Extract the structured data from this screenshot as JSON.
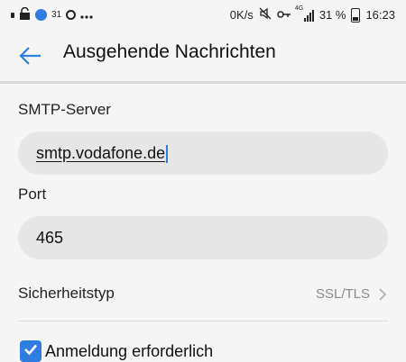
{
  "status_bar": {
    "small_battery_pct": "31",
    "net_speed": "0K/s",
    "network_type": "4G",
    "battery_pct": "31 %",
    "time": "16:23",
    "icons": [
      "notification-dot-icon",
      "lock-icon",
      "globe-icon",
      "loading-ring-icon",
      "more-icon",
      "mute-icon",
      "key-icon",
      "signal-icon",
      "battery-icon"
    ]
  },
  "header": {
    "title": "Ausgehende Nachrichten",
    "back_icon": "arrow-left-icon"
  },
  "form": {
    "smtp_label": "SMTP-Server",
    "smtp_value": "smtp.vodafone.de",
    "port_label": "Port",
    "port_value": "465",
    "security_label": "Sicherheitstyp",
    "security_value": "SSL/TLS",
    "auth_label": "Anmeldung erforderlich",
    "auth_checked": true
  },
  "colors": {
    "accent": "#2f7de1",
    "background": "#f5f5f5",
    "field_bg": "#e6e6e6",
    "muted_text": "#8a8a8a"
  }
}
